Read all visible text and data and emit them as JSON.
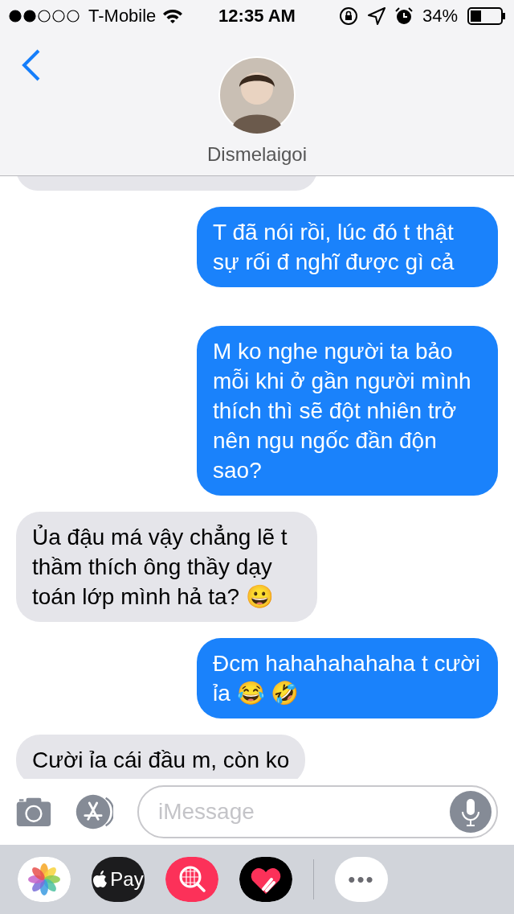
{
  "status_bar": {
    "carrier": "T-Mobile",
    "time": "12:35 AM",
    "battery": "34%"
  },
  "header": {
    "contact_name": "Dismelaigoi"
  },
  "messages": [
    {
      "kind": "incoming"
    },
    {
      "kind": "outgoing",
      "text": "T đã nói rồi, lúc đó t thật sự rối đ nghĩ được gì cả"
    },
    {
      "kind": "outgoing",
      "text": "M ko nghe người ta bảo mỗi khi ở gần người mình thích thì sẽ đột nhiên trở nên ngu ngốc đần độn sao?"
    },
    {
      "kind": "incoming",
      "text": "Ủa đậu má vậy chẳng lẽ t thầm thích ông thầy dạy toán lớp mình hả ta? 😀"
    },
    {
      "kind": "outgoing",
      "text": "Đcm hahahahahaha t cười ỉa 😂 🤣"
    },
    {
      "kind": "incoming",
      "text": "Cười ỉa cái đầu m, còn ko"
    }
  ],
  "composer": {
    "placeholder": "iMessage"
  },
  "app_drawer": {
    "pay_label": "Pay",
    "more_label": "•••"
  }
}
